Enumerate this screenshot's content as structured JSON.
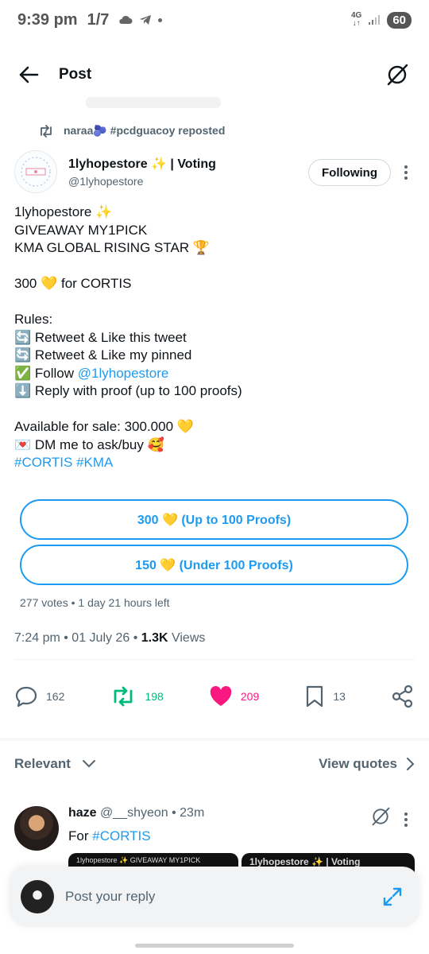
{
  "status_bar": {
    "time": "9:39 pm",
    "notification_count": "1/7",
    "network_top": "4G",
    "network_bottom": "↓↑",
    "battery": "60"
  },
  "app_bar": {
    "title": "Post"
  },
  "repost": {
    "text": "naraa🫐 #pcdguacoy reposted"
  },
  "author": {
    "name": "1lyhopestore ✨ | Voting",
    "handle": "@1lyhopestore",
    "follow_label": "Following"
  },
  "tweet": {
    "lines": [
      "1lyhopestore ✨",
      "GIVEAWAY MY1PICK",
      "KMA GLOBAL RISING STAR 🏆",
      "",
      "300 💛 for CORTIS",
      "",
      "Rules:",
      "🔄 Retweet & Like this tweet",
      "🔄 Retweet & Like my pinned",
      "✅ Follow ",
      "⬇️ Reply with proof (up to 100 proofs)",
      "",
      "Available for sale: 300.000 💛",
      "💌 DM me to ask/buy 🥰"
    ],
    "mention": "@1lyhopestore",
    "hashtags": "#CORTIS #KMA"
  },
  "poll": {
    "options": [
      "300 💛 (Up to 100 Proofs)",
      "150 💛 (Under 100 Proofs)"
    ],
    "meta": "277 votes • 1 day 21 hours left"
  },
  "meta": {
    "time_date": "7:24 pm • 01 July 26 • ",
    "views_count": "1.3K",
    "views_label": " Views"
  },
  "actions": {
    "replies": "162",
    "reposts": "198",
    "likes": "209",
    "bookmarks": "13"
  },
  "colors": {
    "accent": "#1d9bf0",
    "repost": "#00ba7c",
    "like": "#f91880",
    "secondary_text": "#536471"
  },
  "replies_section": {
    "sort_label": "Relevant",
    "view_quotes": "View quotes"
  },
  "reply": {
    "name": "haze",
    "handle_time": " @__shyeon • 23m",
    "text_prefix": "For ",
    "hashtag": "#CORTIS",
    "media_left": "1lyhopestore ✨ GIVEAWAY MY1PICK",
    "media_right": "1lyhopestore ✨ | Voting"
  },
  "composer": {
    "placeholder": "Post your reply"
  }
}
